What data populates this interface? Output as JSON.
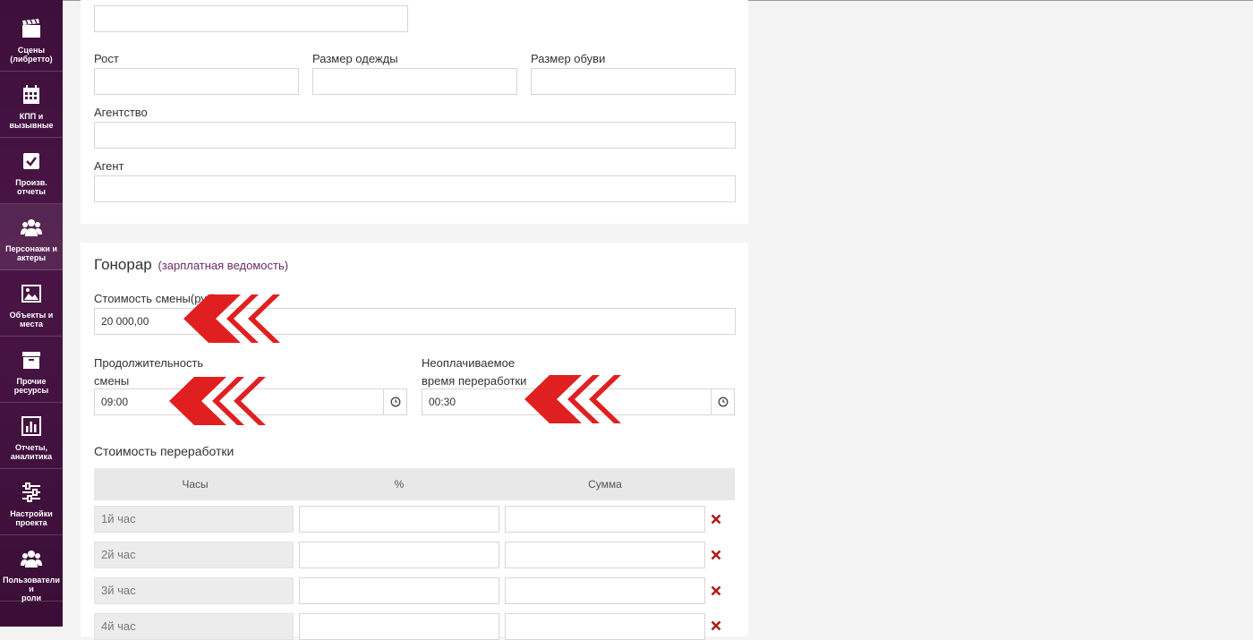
{
  "sidebar": {
    "items": [
      {
        "label_line1": "Сцены",
        "label_line2": "(либретто)",
        "icon": "clapperboard-icon"
      },
      {
        "label_line1": "КПП и",
        "label_line2": "вызывные",
        "icon": "calendar-icon"
      },
      {
        "label_line1": "Произв.",
        "label_line2": "отчеты",
        "icon": "checkbox-icon"
      },
      {
        "label_line1": "Персонажи и",
        "label_line2": "актеры",
        "icon": "users-icon"
      },
      {
        "label_line1": "Объекты и",
        "label_line2": "места",
        "icon": "image-icon"
      },
      {
        "label_line1": "Прочие",
        "label_line2": "ресурсы",
        "icon": "archive-box-icon"
      },
      {
        "label_line1": "Отчеты,",
        "label_line2": "аналитика",
        "icon": "bar-chart-icon"
      },
      {
        "label_line1": "Настройки",
        "label_line2": "проекта",
        "icon": "sliders-icon"
      },
      {
        "label_line1": "Пользователи и",
        "label_line2": "роли",
        "icon": "users-roles-icon"
      }
    ],
    "active_index": 3
  },
  "profile_form": {
    "height_label": "Рост",
    "clothing_size_label": "Размер одежды",
    "shoe_size_label": "Размер обуви",
    "agency_label": "Агентство",
    "agent_label": "Агент",
    "height_value": "",
    "clothing_size_value": "",
    "shoe_size_value": "",
    "agency_value": "",
    "agent_value": ""
  },
  "fee": {
    "title": "Гонорар",
    "subtitle": "(зарплатная ведомость)",
    "shift_cost_label": "Стоимость смены(руб)",
    "shift_cost_value": "20 000,00",
    "shift_duration_label_line1": "Продолжительность",
    "shift_duration_label_line2": "смены",
    "shift_duration_value": "09:00",
    "unpaid_overtime_label_line1": "Неоплачиваемое",
    "unpaid_overtime_label_line2": "время переработки",
    "unpaid_overtime_value": "00:30",
    "overtime_title": "Стоимость переработки",
    "table_headers": {
      "hours": "Часы",
      "percent": "%",
      "sum": "Сумма"
    },
    "rows": [
      {
        "hours": "1й час",
        "percent": "",
        "sum": ""
      },
      {
        "hours": "2й час",
        "percent": "",
        "sum": ""
      },
      {
        "hours": "3й час",
        "percent": "",
        "sum": ""
      },
      {
        "hours": "4й час",
        "percent": "",
        "sum": ""
      }
    ]
  },
  "colors": {
    "sidebar_bg": "#3d0f3a",
    "accent_purple": "#6b2a66",
    "delete_red": "#b01c1c",
    "annotation_arrow_red": "#e02020"
  }
}
